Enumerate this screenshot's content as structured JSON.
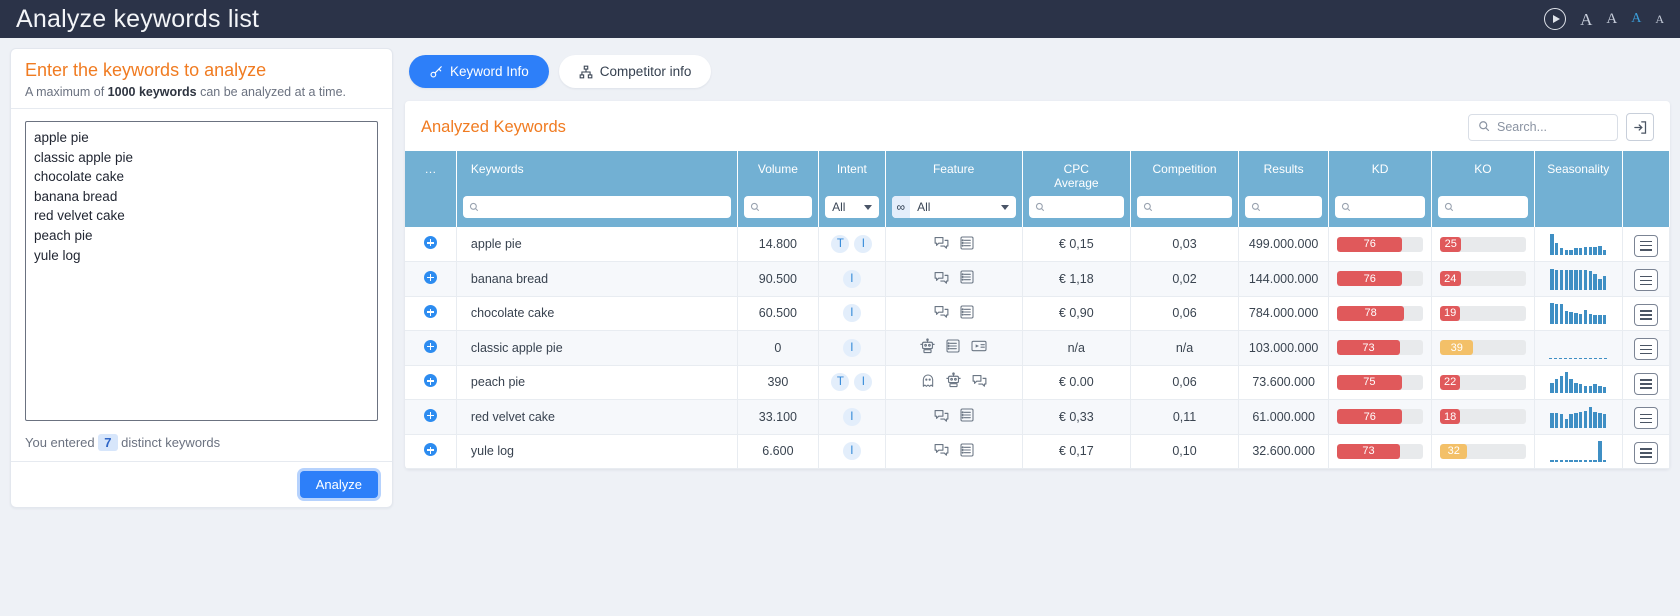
{
  "topbar": {
    "title": "Analyze keywords list",
    "play_icon": "play-circle-icon",
    "font_sizes": [
      "A",
      "A",
      "A",
      "A"
    ],
    "accent": "#3b9dd8"
  },
  "left_panel": {
    "title": "Enter the keywords to analyze",
    "subtitle_pre": "A maximum of ",
    "subtitle_bold": "1000 keywords",
    "subtitle_post": " can be analyzed at a time.",
    "textarea_value": "apple pie\nclassic apple pie\nchocolate cake\nbanana bread\nred velvet cake\npeach pie\nyule log",
    "count_pre": "You entered",
    "count_value": "7",
    "count_post": "distinct keywords",
    "analyze_label": "Analyze",
    "title_color": "#f07b21",
    "button_color": "#2d7ff9"
  },
  "tabs": [
    {
      "label": "Keyword Info",
      "icon": "key-icon",
      "active": true
    },
    {
      "label": "Competitor info",
      "icon": "sitemap-icon",
      "active": false
    }
  ],
  "card": {
    "title": "Analyzed Keywords",
    "search_placeholder": "Search...",
    "search_icon": "search-icon",
    "export_icon": "export-icon"
  },
  "table": {
    "columns": [
      {
        "key": "expand",
        "label": "…"
      },
      {
        "key": "keyword",
        "label": "Keywords"
      },
      {
        "key": "volume",
        "label": "Volume"
      },
      {
        "key": "intent",
        "label": "Intent"
      },
      {
        "key": "feature",
        "label": "Feature"
      },
      {
        "key": "cpc",
        "label": "CPC\nAverage"
      },
      {
        "key": "competition",
        "label": "Competition"
      },
      {
        "key": "results",
        "label": "Results"
      },
      {
        "key": "kd",
        "label": "KD"
      },
      {
        "key": "ko",
        "label": "KO"
      },
      {
        "key": "seasonality",
        "label": "Seasonality"
      },
      {
        "key": "actions",
        "label": ""
      }
    ],
    "filters": {
      "intent_value": "All",
      "feature_value": "All",
      "feature_badge": "∞"
    },
    "rows": [
      {
        "keyword": "apple pie",
        "volume": "14.800",
        "intent": [
          "T",
          "I"
        ],
        "features": [
          "chat-icon",
          "list-icon"
        ],
        "cpc": "€ 0,15",
        "competition": "0,03",
        "results": "499.000.000",
        "kd": 76,
        "ko": 25,
        "ko_color": "#e0595b",
        "seasonality": [
          19,
          11,
          6,
          5,
          5,
          6,
          6,
          7,
          7,
          7,
          8,
          5
        ]
      },
      {
        "keyword": "banana bread",
        "volume": "90.500",
        "intent": [
          "I"
        ],
        "features": [
          "chat-icon",
          "list-icon"
        ],
        "cpc": "€ 1,18",
        "competition": "0,02",
        "results": "144.000.000",
        "kd": 76,
        "ko": 24,
        "ko_color": "#e0595b",
        "seasonality": [
          19,
          18,
          18,
          18,
          18,
          18,
          18,
          18,
          17,
          14,
          10,
          12
        ]
      },
      {
        "keyword": "chocolate cake",
        "volume": "60.500",
        "intent": [
          "I"
        ],
        "features": [
          "chat-icon",
          "list-icon"
        ],
        "cpc": "€ 0,90",
        "competition": "0,06",
        "results": "784.000.000",
        "kd": 78,
        "ko": 19,
        "ko_color": "#e0595b",
        "seasonality": [
          20,
          19,
          19,
          13,
          12,
          11,
          10,
          14,
          10,
          9,
          9,
          9
        ]
      },
      {
        "keyword": "classic apple pie",
        "volume": "0",
        "intent": [
          "I"
        ],
        "features": [
          "robot-icon",
          "list-icon",
          "video-list-icon"
        ],
        "cpc": "n/a",
        "competition": "n/a",
        "results": "103.000.000",
        "kd": 73,
        "ko": 39,
        "ko_color": "#f3c068",
        "seasonality": []
      },
      {
        "keyword": "peach pie",
        "volume": "390",
        "intent": [
          "T",
          "I"
        ],
        "features": [
          "ghost-icon",
          "robot-icon",
          "chat-icon"
        ],
        "cpc": "€ 0.00",
        "competition": "0,06",
        "results": "73.600.000",
        "kd": 75,
        "ko": 22,
        "ko_color": "#e0595b",
        "seasonality": [
          9,
          13,
          16,
          19,
          13,
          9,
          8,
          7,
          7,
          8,
          7,
          6
        ]
      },
      {
        "keyword": "red velvet cake",
        "volume": "33.100",
        "intent": [
          "I"
        ],
        "features": [
          "chat-icon",
          "list-icon"
        ],
        "cpc": "€ 0,33",
        "competition": "0,11",
        "results": "61.000.000",
        "kd": 76,
        "ko": 18,
        "ko_color": "#e0595b",
        "seasonality": [
          14,
          14,
          13,
          8,
          13,
          14,
          15,
          16,
          20,
          15,
          14,
          13
        ]
      },
      {
        "keyword": "yule log",
        "volume": "6.600",
        "intent": [
          "I"
        ],
        "features": [
          "chat-icon",
          "list-icon"
        ],
        "cpc": "€ 0,17",
        "competition": "0,10",
        "results": "32.600.000",
        "kd": 73,
        "ko": 32,
        "ko_color": "#f3c068",
        "seasonality": [
          2,
          2,
          2,
          2,
          2,
          2,
          2,
          2,
          2,
          2,
          20,
          2
        ]
      }
    ],
    "header_bg": "#72b0d3",
    "kd_color": "#e0595b",
    "row_menu_icon": "hamburger-menu-icon",
    "expand_icon": "plus-circle-icon"
  }
}
